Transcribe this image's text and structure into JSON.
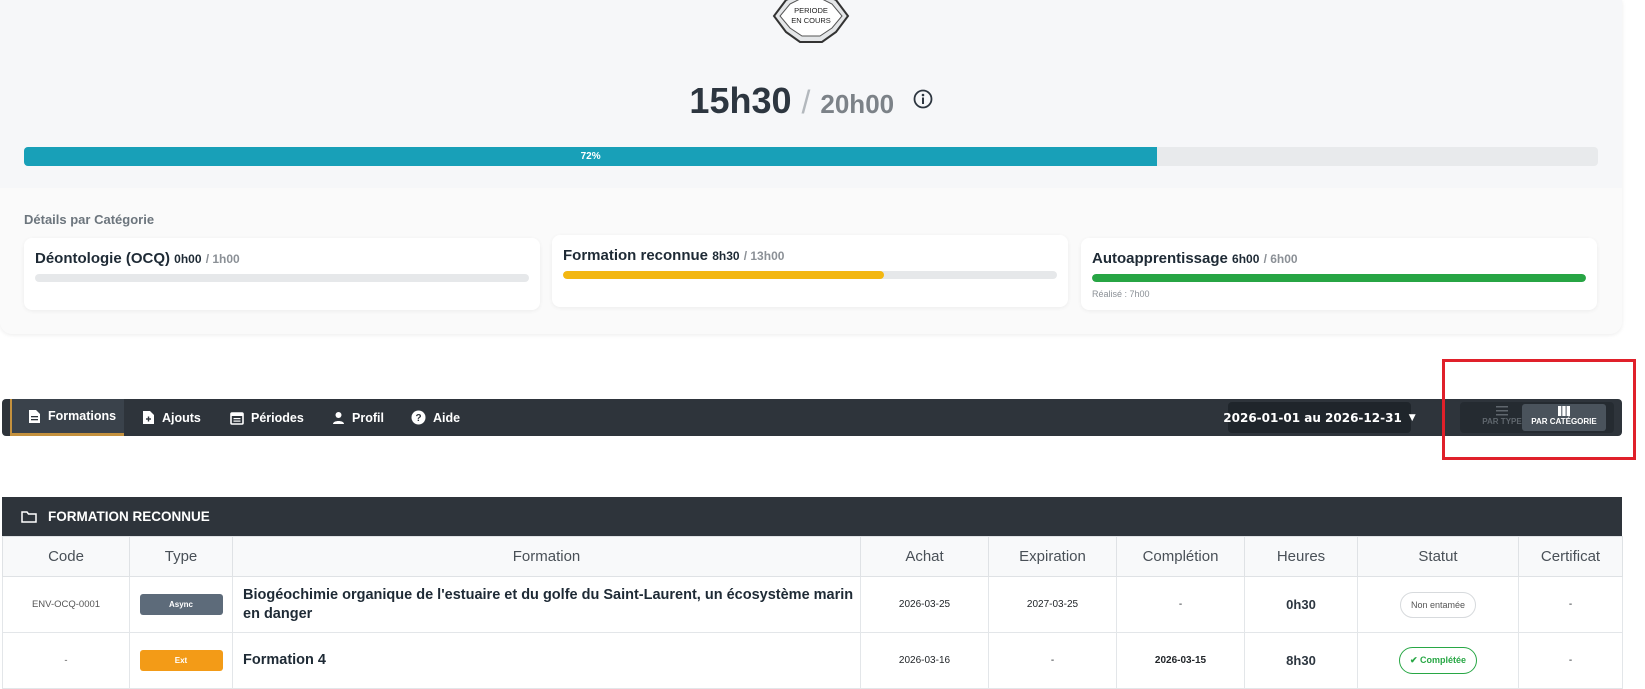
{
  "summary": {
    "badge_line1": "PERIODE",
    "badge_line2": "EN COURS",
    "hours_done": "15h30",
    "separator": "/",
    "hours_total": "20h00",
    "progress_label": "72%",
    "progress_percent": 72
  },
  "details": {
    "title": "Détails par Catégorie",
    "categories": [
      {
        "name": "Déontologie (OCQ)",
        "done": "0h00",
        "total": "/ 1h00",
        "progress": 0,
        "color": "#e6e8ea",
        "note": ""
      },
      {
        "name": "Formation reconnue",
        "done": "8h30",
        "total": "/ 13h00",
        "progress": 65,
        "color": "#f3b711",
        "note": ""
      },
      {
        "name": "Autoapprentissage",
        "done": "6h00",
        "total": "/ 6h00",
        "progress": 100,
        "color": "#27a544",
        "note": "Réalisé : 7h00"
      }
    ]
  },
  "nav": {
    "tabs": [
      {
        "label": "Formations",
        "icon": "document-icon",
        "active": true
      },
      {
        "label": "Ajouts",
        "icon": "file-plus-icon",
        "active": false
      },
      {
        "label": "Périodes",
        "icon": "calendar-icon",
        "active": false
      },
      {
        "label": "Profil",
        "icon": "user-icon",
        "active": false
      },
      {
        "label": "Aide",
        "icon": "help-circle-icon",
        "active": false
      }
    ],
    "date_range": "2026-01-01 au 2026-12-31",
    "view_type_label": "PAR TYPE",
    "view_category_label": "PAR CATÉGORIE"
  },
  "section": {
    "title": "FORMATION RECONNUE",
    "icon": "folder-icon"
  },
  "table": {
    "headers": [
      "Code",
      "Type",
      "Formation",
      "Achat",
      "Expiration",
      "Complétion",
      "Heures",
      "Statut",
      "Certificat"
    ],
    "rows": [
      {
        "code": "ENV-OCQ-0001",
        "type": "Async",
        "type_color": "#5d6b7a",
        "formation": "Biogéochimie organique de l'estuaire et du golfe du Saint-Laurent, un écosystème marin en danger",
        "achat": "2026-03-25",
        "expiration": "2027-03-25",
        "completion": "-",
        "heures": "0h30",
        "statut": "Non entamée",
        "certificat": "-"
      },
      {
        "code": "-",
        "type": "Ext",
        "type_color": "#f39b17",
        "formation": "Formation 4",
        "achat": "2026-03-16",
        "expiration": "-",
        "completion": "2026-03-15",
        "heures": "8h30",
        "statut": "Complétée",
        "certificat": "-"
      }
    ]
  },
  "colors": {
    "accent": "#18a0b8",
    "navbar": "#2e343b",
    "highlight": "#e0202a"
  }
}
